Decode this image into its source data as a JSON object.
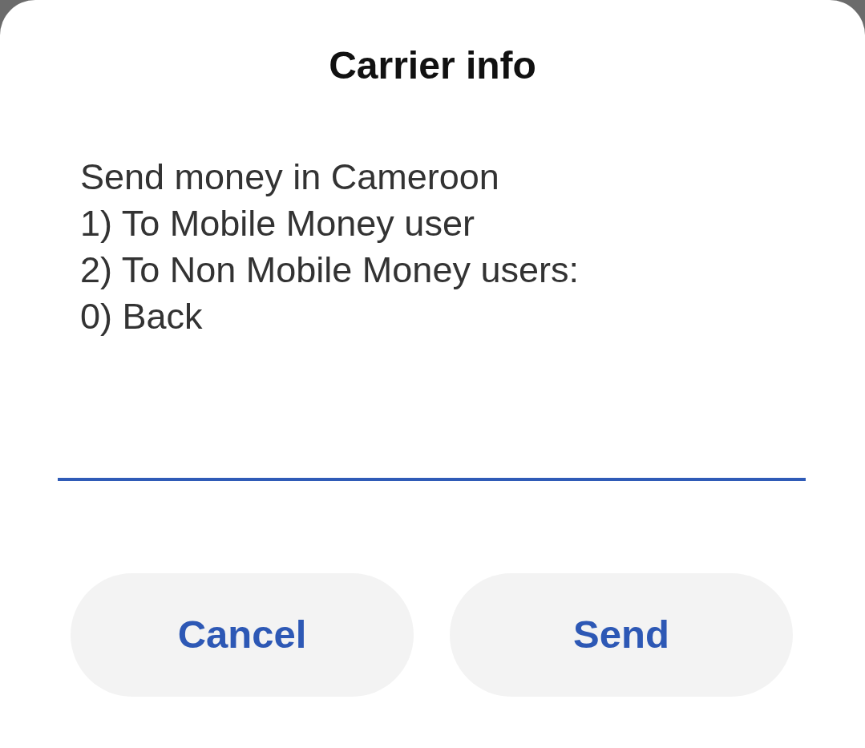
{
  "dialog": {
    "title": "Carrier info",
    "message_lines": [
      "Send money in Cameroon",
      "1) To Mobile Money user",
      "2) To Non Mobile Money users:",
      "0) Back"
    ],
    "buttons": [
      {
        "label": "Cancel"
      },
      {
        "label": "Send"
      }
    ]
  }
}
